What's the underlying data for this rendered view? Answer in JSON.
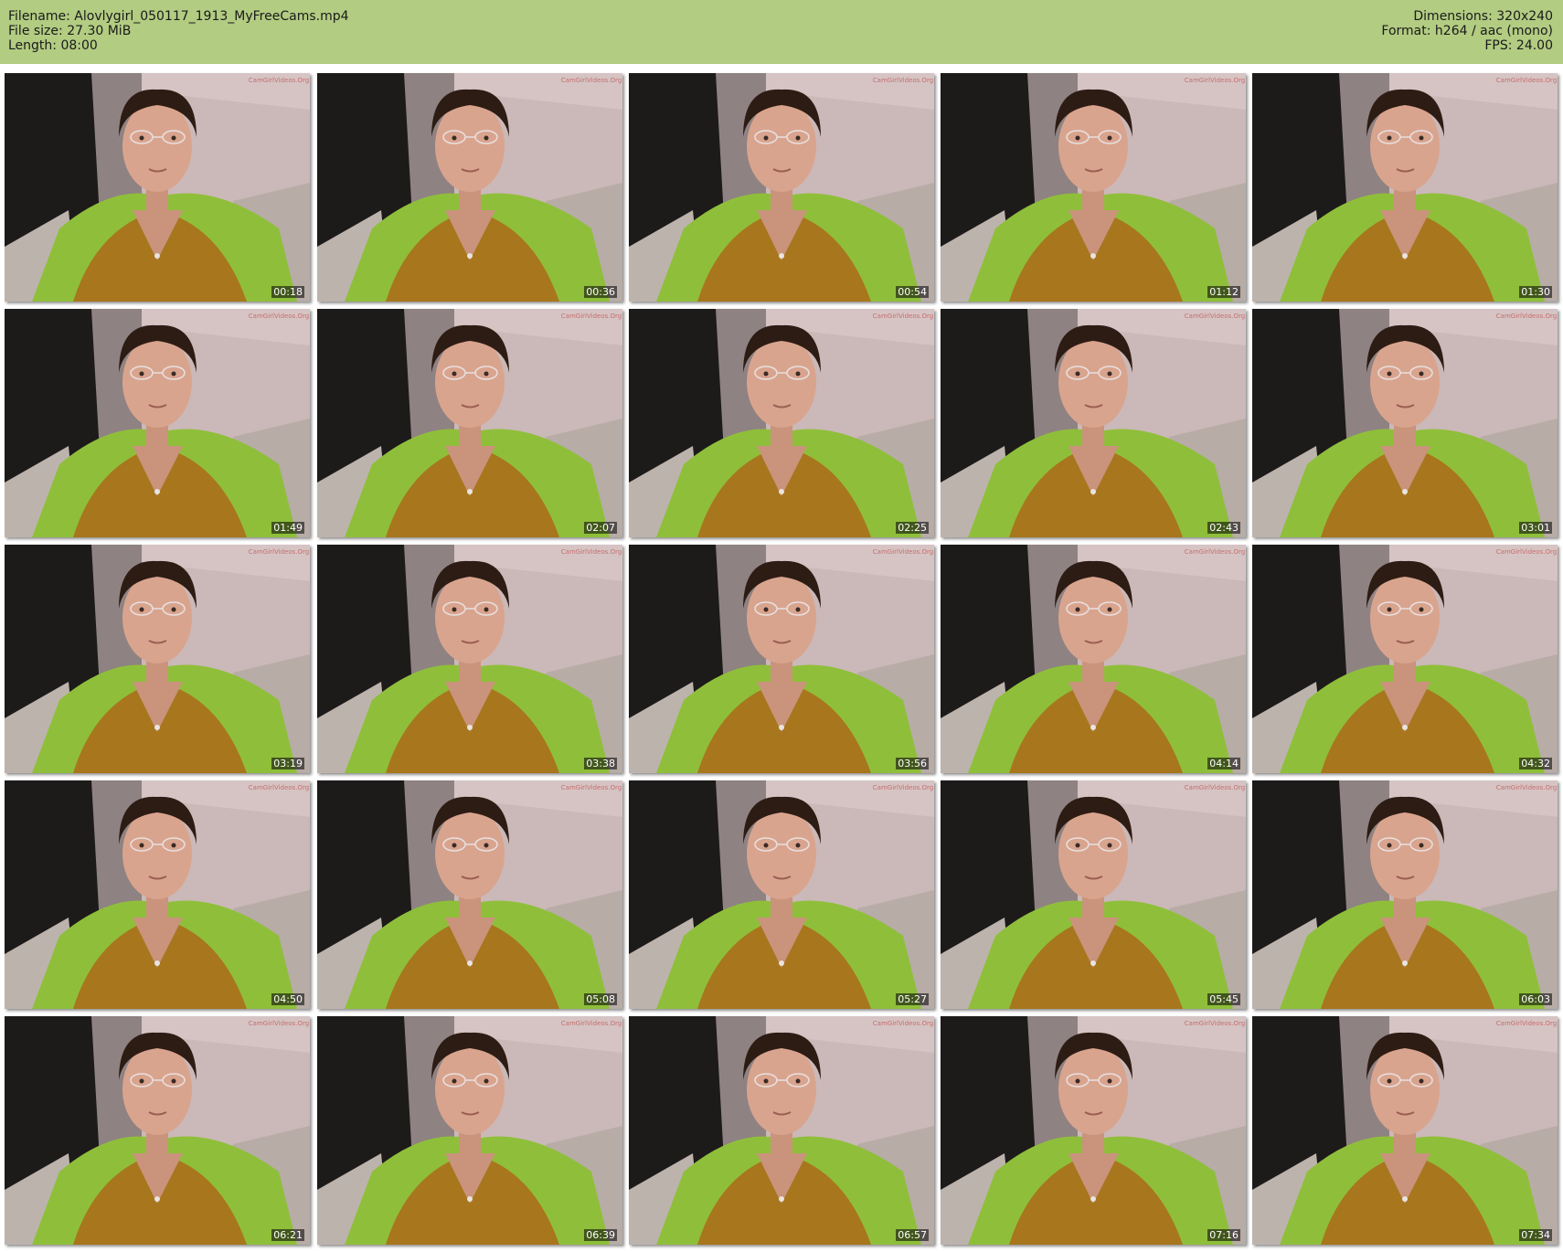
{
  "file": {
    "filename_line": "Filename: Alovlygirl_050117_1913_MyFreeCams.mp4",
    "filesize_line": "File size: 27.30 MiB",
    "length_line": "Length: 08:00",
    "dimensions_line": "Dimensions: 320x240",
    "format_line": "Format: h264 / aac (mono)",
    "fps_line": "FPS: 24.00"
  },
  "colors": {
    "header_bg": "#b2cc82",
    "sweater": "#a8761c",
    "blanket": "#8fbf3a",
    "wall": "#cbb8b8",
    "skin": "#d9a48e",
    "hair": "#2d1c14"
  },
  "thumbnails": [
    {
      "time": "00:18"
    },
    {
      "time": "00:36"
    },
    {
      "time": "00:54"
    },
    {
      "time": "01:12"
    },
    {
      "time": "01:30"
    },
    {
      "time": "01:49"
    },
    {
      "time": "02:07"
    },
    {
      "time": "02:25"
    },
    {
      "time": "02:43"
    },
    {
      "time": "03:01"
    },
    {
      "time": "03:19"
    },
    {
      "time": "03:38"
    },
    {
      "time": "03:56"
    },
    {
      "time": "04:14"
    },
    {
      "time": "04:32"
    },
    {
      "time": "04:50"
    },
    {
      "time": "05:08"
    },
    {
      "time": "05:27"
    },
    {
      "time": "05:45"
    },
    {
      "time": "06:03"
    },
    {
      "time": "06:21"
    },
    {
      "time": "06:39"
    },
    {
      "time": "06:57"
    },
    {
      "time": "07:16"
    },
    {
      "time": "07:34"
    }
  ]
}
